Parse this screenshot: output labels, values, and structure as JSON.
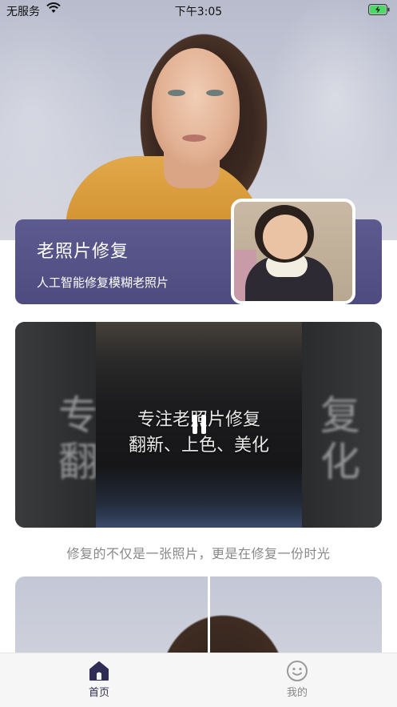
{
  "status_bar": {
    "carrier": "无服务",
    "time": "下午3:05"
  },
  "feature_card": {
    "title": "老照片修复",
    "subtitle": "人工智能修复模糊老照片"
  },
  "video_card": {
    "line1": "专注老照片修复",
    "line2": "翻新、上色、美化",
    "blur_left": "专\n翻",
    "blur_right": "复\n化"
  },
  "caption": "修复的不仅是一张照片，更是在修复一份时光",
  "tab_bar": {
    "items": [
      {
        "label": "首页",
        "icon": "home-icon",
        "active": true
      },
      {
        "label": "我的",
        "icon": "smiley-icon",
        "active": false
      }
    ]
  },
  "colors": {
    "accent": "#4d4b80",
    "tab_active": "#2f2d55",
    "battery": "#4cd964"
  }
}
